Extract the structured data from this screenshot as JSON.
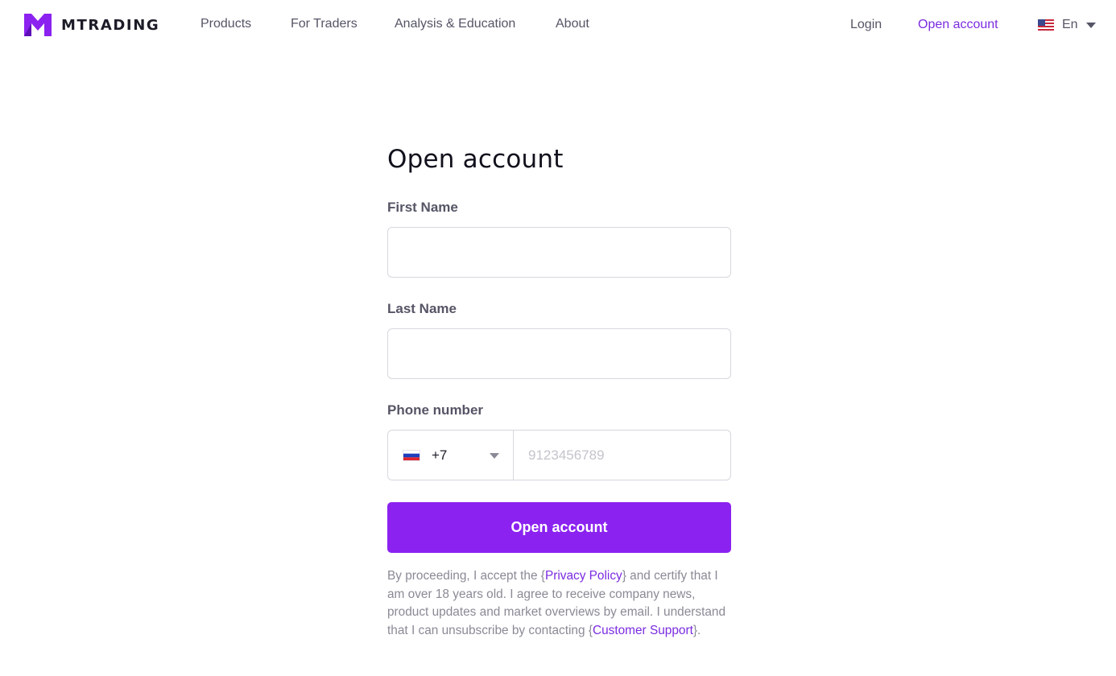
{
  "header": {
    "logo_text": "MTRADING",
    "nav": [
      {
        "label": "Products"
      },
      {
        "label": "For Traders"
      },
      {
        "label": "Analysis & Education"
      },
      {
        "label": "About"
      }
    ],
    "login_label": "Login",
    "open_account_label": "Open account",
    "language": {
      "label": "En",
      "flag_icon": "us-flag-icon"
    }
  },
  "form": {
    "title": "Open account",
    "first_name": {
      "label": "First Name",
      "value": ""
    },
    "last_name": {
      "label": "Last Name",
      "value": ""
    },
    "phone": {
      "label": "Phone number",
      "country_code": "+7",
      "country_flag_icon": "ru-flag-icon",
      "placeholder": "9123456789",
      "value": ""
    },
    "submit_label": "Open account",
    "legal": {
      "part1": "By proceeding, I accept the {",
      "privacy_link": "Privacy Policy",
      "part2": "} and certify that I am over 18 years old. I agree to receive company news, product updates and market overviews by email. I understand that I can unsubscribe by contacting {",
      "support_link": "Customer Support",
      "part3": "}."
    }
  },
  "colors": {
    "accent": "#8b22f0",
    "link": "#7b2be0",
    "text_muted": "#8a8a96",
    "label": "#555566"
  }
}
